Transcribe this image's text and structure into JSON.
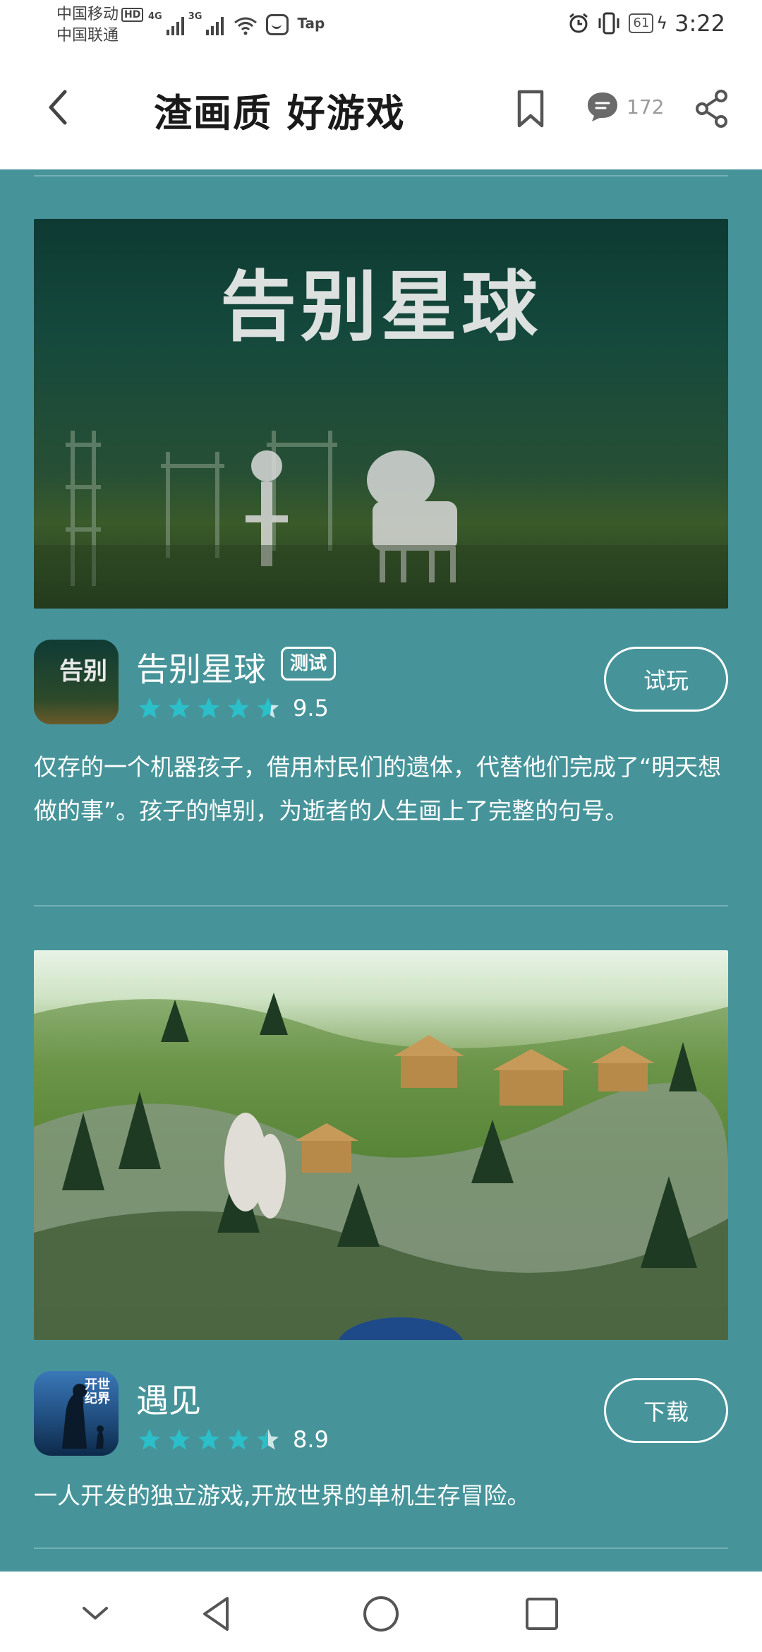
{
  "status_bar": {
    "carrier_1": "中国移动",
    "carrier_1_badge": "HD",
    "carrier_2": "中国联通",
    "net_1": "4G",
    "net_2": "3G",
    "app_badge": "Tap",
    "battery": "61",
    "time": "3:22"
  },
  "header": {
    "title": "渣画质 好游戏",
    "comment_count": "172"
  },
  "games": [
    {
      "banner_title": "告别星球",
      "icon_text": "告别",
      "name": "告别星球",
      "badge": "测试",
      "rating_value": 9.5,
      "rating": "9.5",
      "button": "试玩",
      "description": "仅存的一个机器孩子，借用村民们的遗体，代替他们完成了“明天想做的事”。孩子的悼别，为逝者的人生画上了完整的句号。"
    },
    {
      "icon_text": "开世 纪界",
      "name": "遇见",
      "rating_value": 8.9,
      "rating": "8.9",
      "button": "下载",
      "description": "一人开发的独立游戏,开放世界的单机生存冒险。"
    }
  ],
  "colors": {
    "content_bg": "#46949a",
    "star_fill": "#2bbfc9"
  }
}
